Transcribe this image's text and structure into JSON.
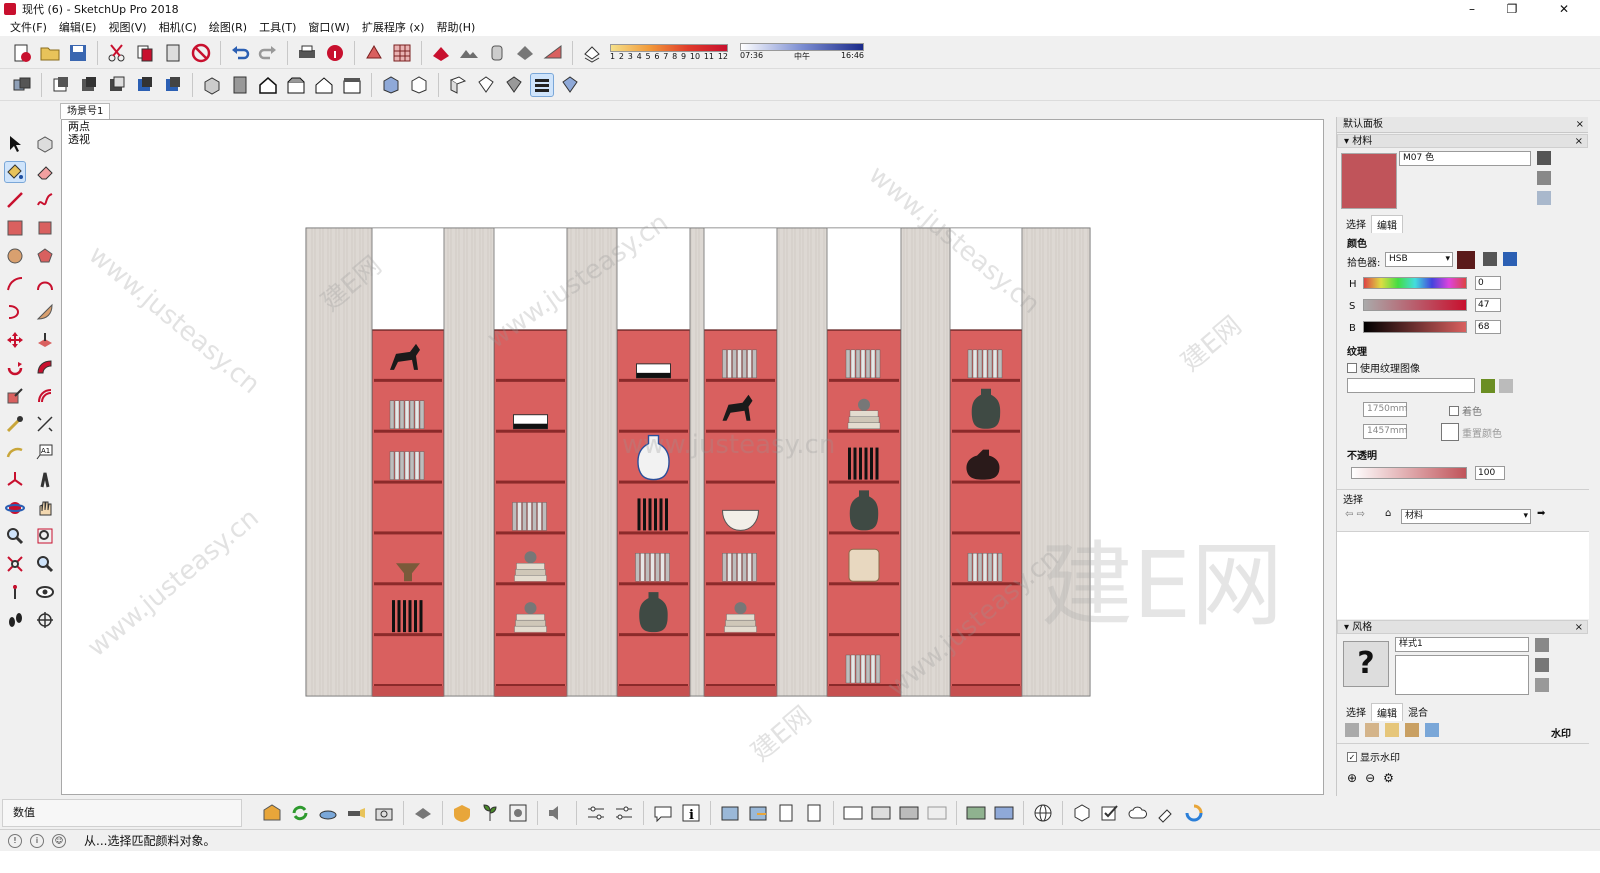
{
  "window": {
    "title": "现代 (6) - SketchUp Pro 2018",
    "controls": [
      "–",
      "❐",
      "✕"
    ]
  },
  "menu": [
    "文件(F)",
    "编辑(E)",
    "视图(V)",
    "相机(C)",
    "绘图(R)",
    "工具(T)",
    "窗口(W)",
    "扩展程序 (x)",
    "帮助(H)"
  ],
  "shadow": {
    "scale_labels": [
      "1",
      "2",
      "3",
      "4",
      "5",
      "6",
      "7",
      "8",
      "9",
      "10",
      "11",
      "12"
    ],
    "time_labels": [
      "07:36",
      "中午",
      "16:46"
    ]
  },
  "scene_tab": "场景号1",
  "viewport": {
    "label_line1": "两点",
    "label_line2": "透视",
    "watermark_text": "www.justeasy.cn",
    "watermark_brand": "建E网"
  },
  "tray": {
    "title": "默认面板",
    "materials": {
      "header": "材料",
      "name": "M07 色",
      "tab_select": "选择",
      "tab_edit": "编辑",
      "color_label": "颜色",
      "picker_label": "拾色器:",
      "picker_value": "HSB",
      "h_label": "H",
      "h_value": "0",
      "s_label": "S",
      "s_value": "47",
      "b_label": "B",
      "b_value": "68",
      "texture_label": "纹理",
      "use_texture": "使用纹理图像",
      "width_value": "1750mm",
      "height_value": "1457mm",
      "colorize": "着色",
      "reset_color": "重置颜色",
      "opacity_label": "不透明",
      "opacity_value": "100",
      "select_label": "选择",
      "library_value": "材料",
      "swatch_color": "#c0545a"
    },
    "styles": {
      "header": "风格",
      "name": "样式1",
      "tab_select": "选择",
      "tab_edit": "编辑",
      "tab_mix": "混合",
      "watermark_label": "水印",
      "show_watermark": "显示水印"
    }
  },
  "bottom": {
    "measurements_label": "数值"
  },
  "status": {
    "text": "从...选择匹配颜料对象。"
  },
  "colors": {
    "shelf_red": "#d9605f",
    "wood_panel": "#dcd6d2",
    "accent_red": "#c8102e"
  }
}
